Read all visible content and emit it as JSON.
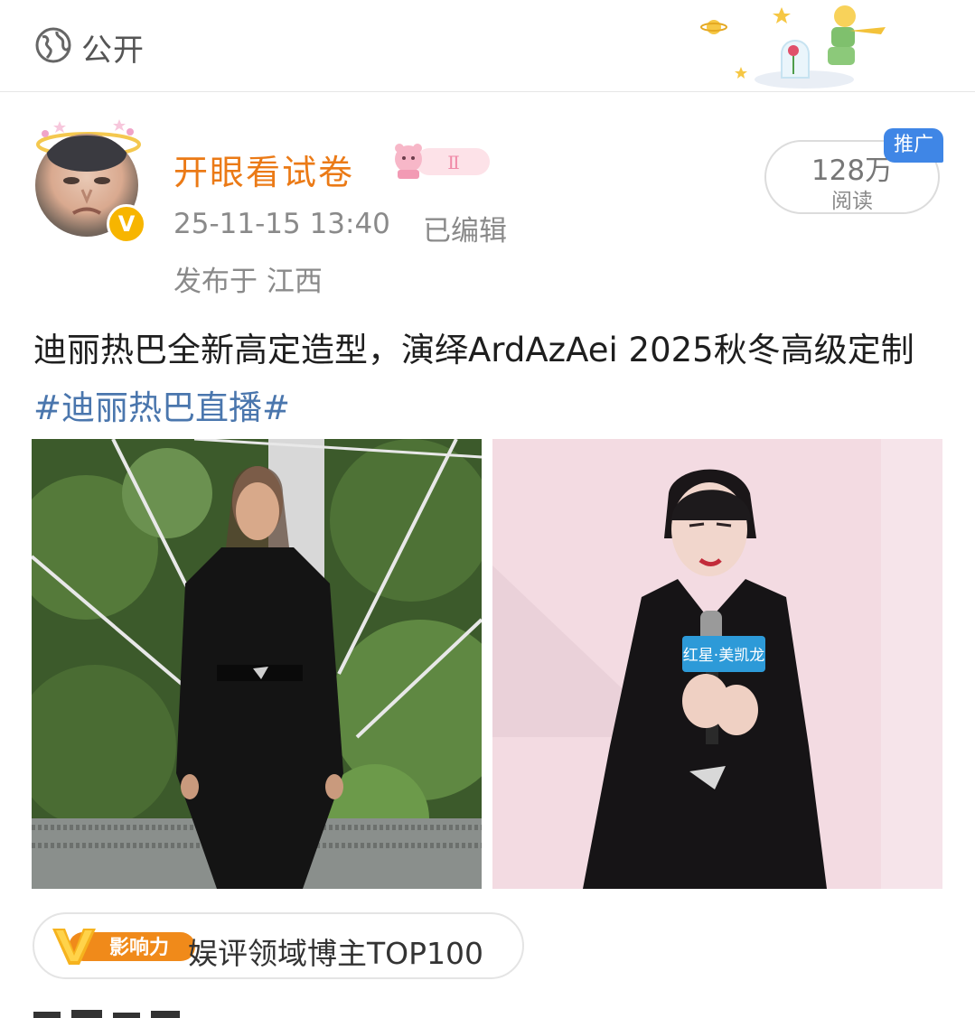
{
  "header": {
    "visibility_label": "公开",
    "visibility_icon": "globe-icon"
  },
  "post": {
    "author": {
      "name": "开眼看试卷",
      "verified_icon": "verified-v-icon",
      "level_badge_text": "Ⅱ"
    },
    "timestamp": "25-11-15 13:40",
    "edited_label": "已编辑",
    "location": "发布于 江西",
    "reads": {
      "count": "128万",
      "label": "阅读",
      "promo_tag": "推广"
    },
    "text": "迪丽热巴全新高定造型，演绎ArdAzAei 2025秋冬高级定制 ",
    "hashtag": "#迪丽热巴直播#",
    "images": [
      {
        "icon": "runway-photo-image"
      },
      {
        "icon": "event-photo-image",
        "mic_label": "红星·美凯龙"
      }
    ],
    "influence": {
      "logo_text": "影响力",
      "text": "娱评领域博主TOP100"
    }
  },
  "colors": {
    "author_name": "#eb7a16",
    "hashtag": "#4a76ad",
    "promo_tag_bg": "#3f86e6",
    "meta_text": "#8a8a8a",
    "influence_orange": "#f08a1a"
  }
}
